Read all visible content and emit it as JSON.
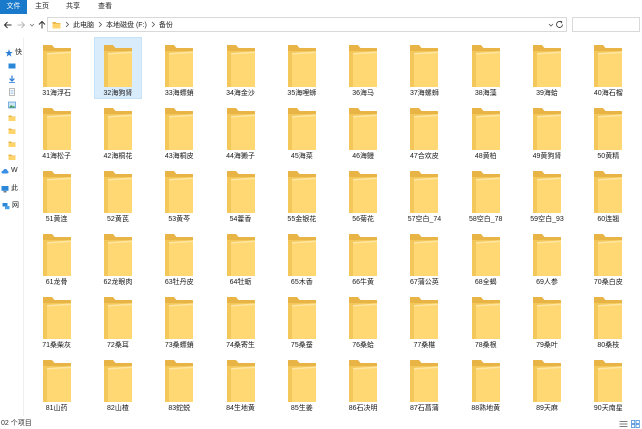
{
  "ribbon": {
    "tabs": [
      {
        "label": "文件"
      },
      {
        "label": "主页"
      },
      {
        "label": "共享"
      },
      {
        "label": "查看"
      }
    ]
  },
  "address": {
    "crumbs": [
      "此电脑",
      "本地磁盘 (F:)",
      "备份"
    ]
  },
  "nav_pane": {
    "items": [
      {
        "icon": "star-icon",
        "label": "快"
      },
      {
        "icon": "desktop-icon"
      },
      {
        "icon": "download-icon"
      },
      {
        "icon": "document-icon"
      },
      {
        "icon": "picture-icon"
      },
      {
        "icon": "folder-icon"
      },
      {
        "icon": "folder-icon"
      },
      {
        "icon": "folder-icon"
      },
      {
        "icon": "folder-icon"
      },
      {
        "icon": "wps-cloud-icon",
        "label": "W"
      },
      {
        "icon": "computer-icon",
        "label": "此"
      },
      {
        "icon": "network-icon",
        "label": "网"
      }
    ]
  },
  "folders": [
    {
      "name": "31海浮石"
    },
    {
      "name": "32海狗肾",
      "selected": true
    },
    {
      "name": "33海螵蛸"
    },
    {
      "name": "34海金沙"
    },
    {
      "name": "35海哩蛳"
    },
    {
      "name": "36海马"
    },
    {
      "name": "37海螺蛳"
    },
    {
      "name": "38海藻"
    },
    {
      "name": "39海蛤"
    },
    {
      "name": "40海石榴"
    },
    {
      "name": "41海松子"
    },
    {
      "name": "42海桐花"
    },
    {
      "name": "43海桐皮"
    },
    {
      "name": "44海獭子"
    },
    {
      "name": "45海菜"
    },
    {
      "name": "46海鳗"
    },
    {
      "name": "47合欢皮"
    },
    {
      "name": "48黄柏"
    },
    {
      "name": "49黄狗肾"
    },
    {
      "name": "50黄精"
    },
    {
      "name": "51黄连"
    },
    {
      "name": "52黄芪"
    },
    {
      "name": "53黄芩"
    },
    {
      "name": "54藿香"
    },
    {
      "name": "55金银花"
    },
    {
      "name": "56菊花"
    },
    {
      "name": "57空白_74"
    },
    {
      "name": "58空白_78"
    },
    {
      "name": "59空白_93"
    },
    {
      "name": "60连翘"
    },
    {
      "name": "61龙骨"
    },
    {
      "name": "62龙眼肉"
    },
    {
      "name": "63牡丹皮"
    },
    {
      "name": "64牡蛎"
    },
    {
      "name": "65木香"
    },
    {
      "name": "66牛黄"
    },
    {
      "name": "67蒲公英"
    },
    {
      "name": "68全蝎"
    },
    {
      "name": "69人参"
    },
    {
      "name": "70桑白皮"
    },
    {
      "name": "71桑柴灰"
    },
    {
      "name": "72桑耳"
    },
    {
      "name": "73桑螵蛸"
    },
    {
      "name": "74桑寄生"
    },
    {
      "name": "75桑蚕"
    },
    {
      "name": "76桑蛤"
    },
    {
      "name": "77桑椹"
    },
    {
      "name": "78桑根"
    },
    {
      "name": "79桑叶"
    },
    {
      "name": "80桑枝"
    },
    {
      "name": "81山药"
    },
    {
      "name": "82山楂"
    },
    {
      "name": "83蛇蜕"
    },
    {
      "name": "84生地黄"
    },
    {
      "name": "85生姜"
    },
    {
      "name": "86石决明"
    },
    {
      "name": "87石菖蒲"
    },
    {
      "name": "88熟地黄"
    },
    {
      "name": "89天麻"
    },
    {
      "name": "90天南星"
    }
  ],
  "status": {
    "item_count": "02 个项目"
  },
  "colors": {
    "accent": "#1979ca",
    "selection_bg": "#d9ecfc",
    "selection_border": "#c4e2fa",
    "folder_back": "#e9b446",
    "folder_body": "#f4c75a",
    "folder_front": "#ffd874"
  }
}
